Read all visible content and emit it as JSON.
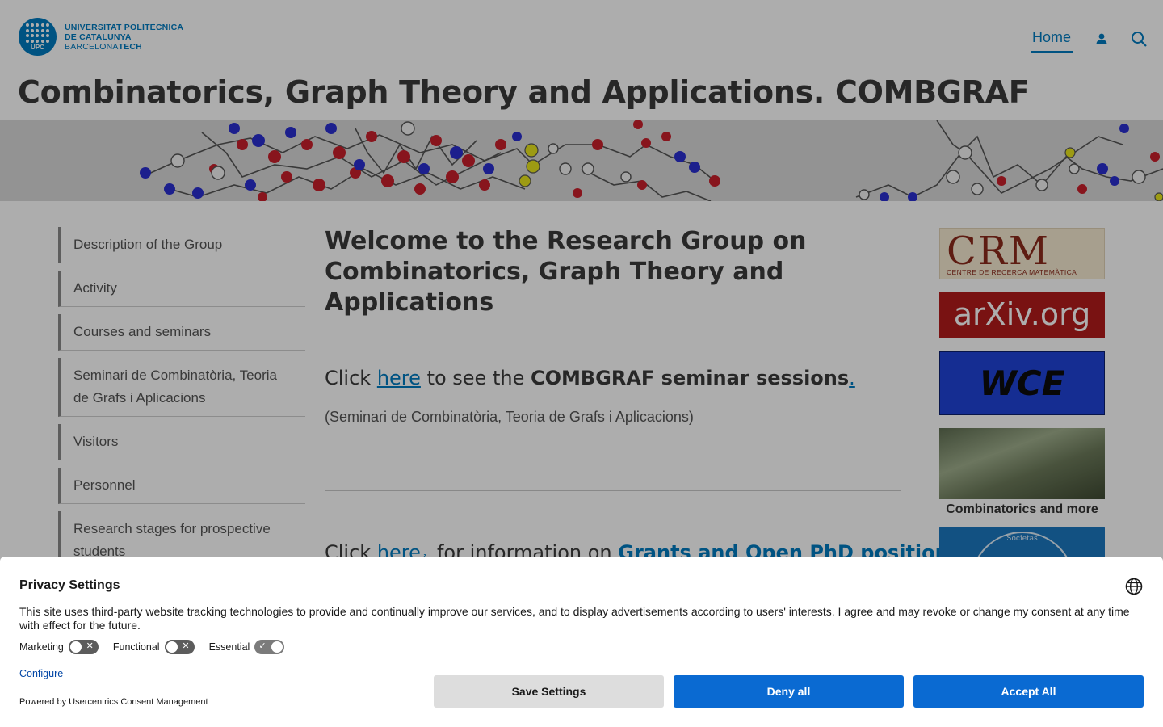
{
  "logo": {
    "line1": "UNIVERSITAT POLITÈCNICA",
    "line2": "DE CATALUNYA",
    "line3a": "BARCELONA",
    "line3b": "TECH",
    "badge": "UPC",
    "brand_color": "#007bc0"
  },
  "nav": {
    "home": "Home",
    "icons": [
      "user-icon",
      "search-icon"
    ]
  },
  "site_title": {
    "main": "Combinatorics, Graph Theory and Applications.",
    "acronym": "COMBGRAF"
  },
  "sidebar": {
    "items": [
      {
        "label": "Description of the Group"
      },
      {
        "label": "Activity"
      },
      {
        "label": "Courses and seminars"
      },
      {
        "label": "Seminari de Combinatòria, Teoria de Grafs i Aplicacions"
      },
      {
        "label": "Visitors"
      },
      {
        "label": "Personnel"
      },
      {
        "label": "Research stages for prospective students"
      }
    ]
  },
  "main": {
    "welcome": "Welcome to the Research Group on Combinatorics, Graph Theory and Applications",
    "seminar_line": {
      "prefix": "Click",
      "link": "here",
      "middle": "to see the",
      "bold": "COMBGRAF seminar sessions",
      "dot": "."
    },
    "seminar_sub": "(Seminari de Combinatòria, Teoria de Grafs i Aplicacions)",
    "grants_line": {
      "prefix": "Click",
      "link": "here",
      "middle": "for information on",
      "bold": "Grants and Open PhD positions"
    }
  },
  "right_column": {
    "crm_big": "CRM",
    "crm_small": "CENTRE DE RECERCA MATEMÀTICA",
    "arxiv": "arXiv.org",
    "wce": "WCE",
    "photo_caption": "Combinatorics and more",
    "badge_text": "Societas"
  },
  "consent": {
    "title": "Privacy Settings",
    "message": "This site uses third-party website tracking technologies to provide and continually improve our services, and to display advertisements according to users' interests. I agree and may revoke or change my consent at any time with effect for the future.",
    "toggles": [
      {
        "label": "Marketing",
        "state": "off"
      },
      {
        "label": "Functional",
        "state": "off"
      },
      {
        "label": "Essential",
        "state": "on"
      }
    ],
    "configure": "Configure",
    "powered": "Powered by Usercentrics Consent Management",
    "save": "Save Settings",
    "deny": "Deny all",
    "accept": "Accept All",
    "accent_color": "#0a6ad2"
  }
}
